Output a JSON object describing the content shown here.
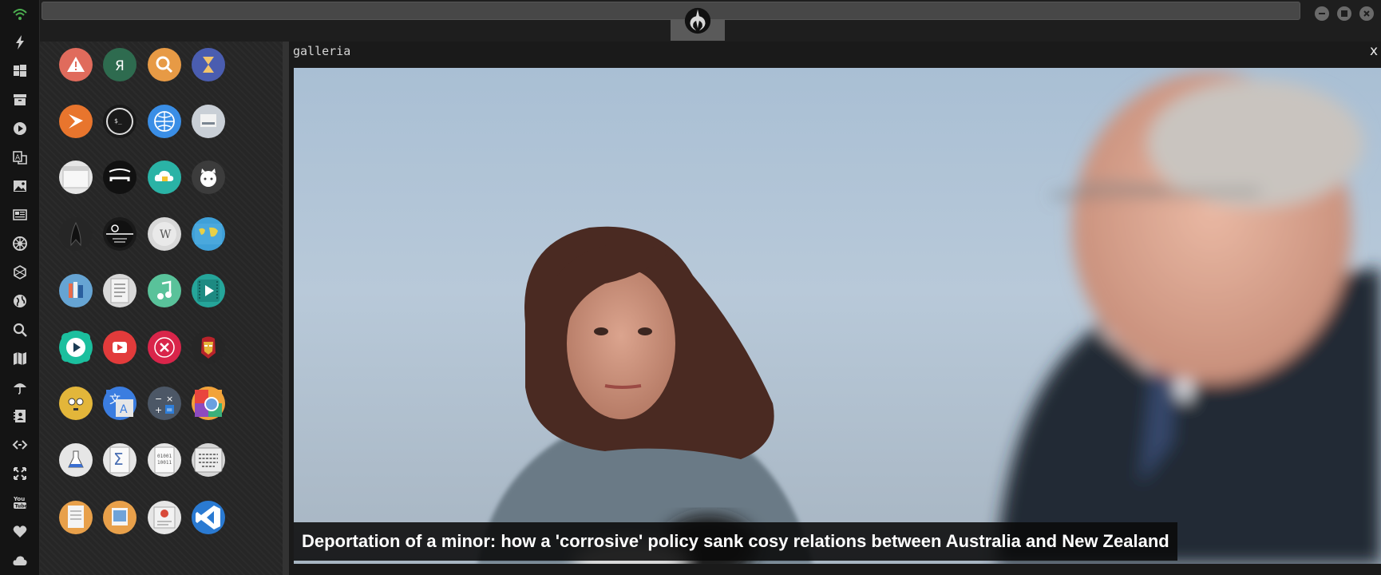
{
  "dock": {
    "items": [
      {
        "icon": "wifi-icon"
      },
      {
        "icon": "lightning-icon"
      },
      {
        "icon": "windows-icon"
      },
      {
        "icon": "archive-icon"
      },
      {
        "icon": "play-circle-icon"
      },
      {
        "icon": "translate-icon"
      },
      {
        "icon": "image-icon"
      },
      {
        "icon": "news-icon"
      },
      {
        "icon": "galactic-empire-icon"
      },
      {
        "icon": "hexagon-icon"
      },
      {
        "icon": "globe-icon"
      },
      {
        "icon": "search-icon"
      },
      {
        "icon": "map-icon"
      },
      {
        "icon": "umbrella-icon"
      },
      {
        "icon": "contact-book-icon"
      },
      {
        "icon": "code-icon"
      },
      {
        "icon": "expand-icon"
      },
      {
        "icon": "youtube-icon"
      },
      {
        "icon": "heart-icon"
      },
      {
        "icon": "cloud-icon"
      }
    ]
  },
  "topbar": {
    "center_icon": "rebel-alliance-icon",
    "window_buttons": [
      "minimize-icon",
      "maximize-icon",
      "close-icon"
    ]
  },
  "apps": [
    {
      "icon": "warning-icon",
      "color": "#e06b5c"
    },
    {
      "icon": "yandex-icon",
      "color": "#2e6b4f"
    },
    {
      "icon": "search-app-icon",
      "color": "#e79a45"
    },
    {
      "icon": "hourglass-icon",
      "color": "#4a5db0"
    },
    {
      "icon": "sublime-icon",
      "color": "#e8752d"
    },
    {
      "icon": "terminal-icon",
      "color": "#1a1a1a"
    },
    {
      "icon": "globe-app-icon",
      "color": "#3a8ee6"
    },
    {
      "icon": "printer-icon",
      "color": "#c9cfd6"
    },
    {
      "icon": "window-app-icon",
      "color": "#e6e6e6"
    },
    {
      "icon": "dash-app-icon",
      "color": "#111111"
    },
    {
      "icon": "cloud-lock-icon",
      "color": "#2ab3a6"
    },
    {
      "icon": "github-icon",
      "color": "#3c3c3c"
    },
    {
      "icon": "starfleet-icon",
      "color": "#262626"
    },
    {
      "icon": "death-star-icon",
      "color": "#1a1a1a"
    },
    {
      "icon": "wikipedia-icon",
      "color": "#d8d8d8"
    },
    {
      "icon": "world-map-icon",
      "color": "#3fa0d8"
    },
    {
      "icon": "books-icon",
      "color": "#66a4d3"
    },
    {
      "icon": "document-icon",
      "color": "#d9d9d9"
    },
    {
      "icon": "music-icon",
      "color": "#59c29a"
    },
    {
      "icon": "video-icon",
      "color": "#25a59a"
    },
    {
      "icon": "player-icon",
      "color": "#1bbf9e"
    },
    {
      "icon": "youtube-app-icon",
      "color": "#e23b3b"
    },
    {
      "icon": "cancel-app-icon",
      "color": "#d9254a"
    },
    {
      "icon": "ironman-icon",
      "color": "#262626"
    },
    {
      "icon": "c3po-icon",
      "color": "#e3b63a"
    },
    {
      "icon": "translate-app-icon",
      "color": "#3b7de0"
    },
    {
      "icon": "calculator-icon",
      "color": "#4c5766"
    },
    {
      "icon": "color-picker-icon",
      "color": "#f2a33a"
    },
    {
      "icon": "flask-icon",
      "color": "#e6e6e6"
    },
    {
      "icon": "sigma-icon",
      "color": "#e6e6e6"
    },
    {
      "icon": "binary-icon",
      "color": "#e6e6e6"
    },
    {
      "icon": "keyboard-icon",
      "color": "#d6d6d6"
    },
    {
      "icon": "text-file-icon",
      "color": "#e8a04a"
    },
    {
      "icon": "picture-app-icon",
      "color": "#e8a04a"
    },
    {
      "icon": "presentation-icon",
      "color": "#e6e6e6"
    },
    {
      "icon": "vscode-icon",
      "color": "#2a7ad2"
    }
  ],
  "viewer": {
    "title": "galleria",
    "close": "x",
    "caption": "Deportation of a minor: how a 'corrosive' policy sank cosy relations between Australia and New Zealand"
  }
}
